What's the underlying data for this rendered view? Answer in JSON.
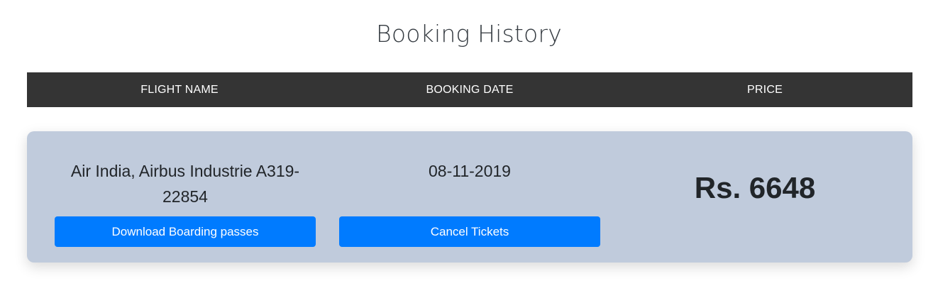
{
  "page": {
    "title": "Booking History"
  },
  "table_header": {
    "columns": [
      "FLIGHT NAME",
      "BOOKING DATE",
      "PRICE"
    ]
  },
  "bookings": [
    {
      "flight_name": "Air India, Airbus Industrie A319-22854",
      "flight_name_line1": "Air India, Airbus Industrie A319-",
      "flight_name_line2": "22854",
      "booking_date": "08-11-2019",
      "price": "Rs. 6648",
      "download_label": "Download Boarding passes",
      "cancel_label": "Cancel Tickets"
    }
  ],
  "colors": {
    "header_bg": "#343434",
    "card_bg": "#c0cbdc",
    "button_bg": "#007bff"
  }
}
